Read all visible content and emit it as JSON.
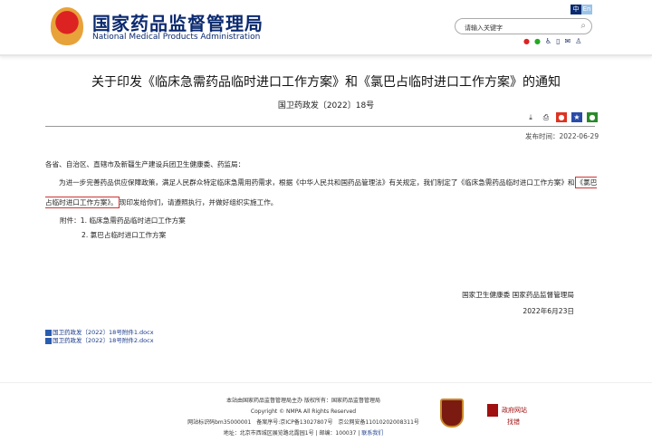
{
  "header": {
    "logo_cn": "国家药品监督管理局",
    "logo_en": "National Medical Products Administration",
    "lang": [
      "中",
      "En"
    ],
    "search_placeholder": "请输入关键字",
    "icons": [
      "weibo-icon",
      "wechat-icon",
      "accessibility-icon",
      "mobile-icon",
      "mail-icon",
      "user-icon"
    ]
  },
  "article": {
    "title": "关于印发《临床急需药品临时进口工作方案》和《氯巴占临时进口工作方案》的通知",
    "doc_no": "国卫药政发〔2022〕18号",
    "publish_date": "发布时间：2022-06-29",
    "salutation": "各省、自治区、直辖市及新疆生产建设兵团卫生健康委、药监局：",
    "para_a": "为进一步完善药品供应保障政策，满足人民群众特定临床急需用药需求，根据《中华人民共和国药品管理法》有关规定，我们制定了《临床急需药品临时进口工作方案》和",
    "para_highlight": "《氯巴占临时进口工作方案》。",
    "para_b": "现印发给你们，请遵照执行，并做好组织实施工作。",
    "attachments_label": "附件：",
    "attachments": [
      "1. 临床急需药品临时进口工作方案",
      "2. 氯巴占临时进口工作方案"
    ],
    "signers": "国家卫生健康委 国家药品监督管理局",
    "sign_date": "2022年6月23日",
    "files": [
      "国卫药政发〔2022〕18号附件1.docx",
      "国卫药政发〔2022〕18号附件2.docx"
    ]
  },
  "footer": {
    "line1": "本站由国家药品监督管理局主办 版权所有：国家药品监督管理局",
    "line2": "Copyright © NMPA All Rights Reserved",
    "line3": "网站标识码bm35000001　备案序号:京ICP备13027807号　京公网安备11010202008311号",
    "line4": "地址：北京市西城区展览路北露园1号 | 邮编：100037 |",
    "contact": "联系我们",
    "gov_title": "政府网站",
    "gov_sub": "找错"
  }
}
